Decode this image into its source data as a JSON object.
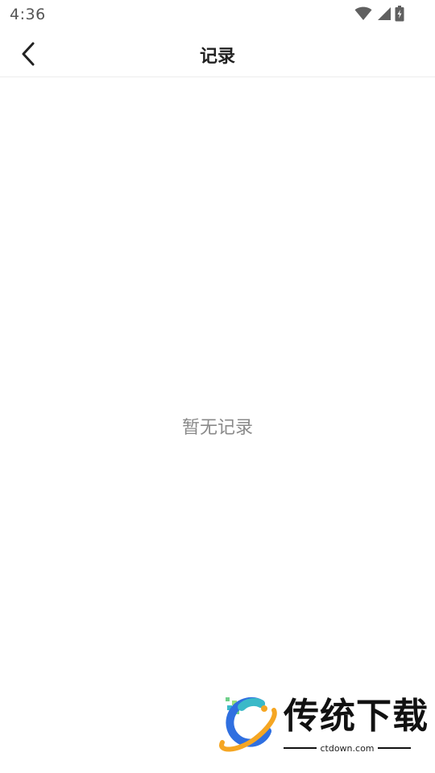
{
  "status_bar": {
    "time": "4:36",
    "icons": [
      "wifi-icon",
      "signal-icon",
      "battery-charging-icon"
    ]
  },
  "header": {
    "back_icon": "chevron-left-icon",
    "title": "记录"
  },
  "main": {
    "empty_message": "暂无记录"
  },
  "watermark": {
    "name": "传统下载",
    "domain": "ctdown.com",
    "colors": {
      "orange": "#f5a623",
      "blue": "#2f6fe0",
      "green": "#6fd08a",
      "teal": "#3ab9c8"
    }
  }
}
